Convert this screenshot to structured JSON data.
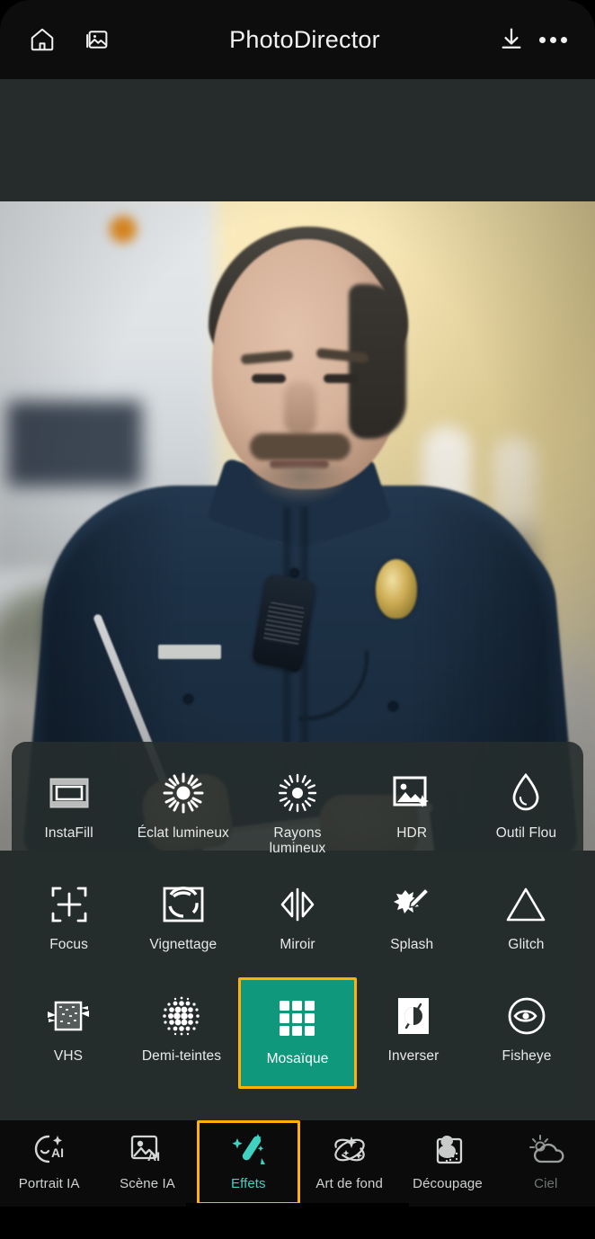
{
  "topbar": {
    "title": "PhotoDirector",
    "home_icon": "home-icon",
    "gallery_icon": "gallery-icon",
    "download_icon": "download-icon",
    "more_icon": "more-options-icon"
  },
  "photo": {
    "alt": "police officer writing on a notepad, blurred street background"
  },
  "effects_panel": {
    "selected": "Mosaïque",
    "selected_bg": "#10987c",
    "selection_border": "#ffb300",
    "rows": [
      [
        {
          "label": "InstaFill",
          "icon": "instafill-icon"
        },
        {
          "label": "Éclat lumineux",
          "icon": "light-burst-icon"
        },
        {
          "label": "Rayons\nlumineux",
          "icon": "light-rays-icon"
        },
        {
          "label": "HDR",
          "icon": "hdr-icon"
        },
        {
          "label": "Outil Flou",
          "icon": "blur-tool-icon"
        }
      ],
      [
        {
          "label": "Focus",
          "icon": "focus-icon"
        },
        {
          "label": "Vignettage",
          "icon": "vignette-icon"
        },
        {
          "label": "Miroir",
          "icon": "mirror-icon"
        },
        {
          "label": "Splash",
          "icon": "splash-icon"
        },
        {
          "label": "Glitch",
          "icon": "glitch-icon"
        }
      ],
      [
        {
          "label": "VHS",
          "icon": "vhs-icon"
        },
        {
          "label": "Demi-teintes",
          "icon": "halftone-icon"
        },
        {
          "label": "Mosaïque",
          "icon": "mosaic-icon"
        },
        {
          "label": "Inverser",
          "icon": "invert-icon"
        },
        {
          "label": "Fisheye",
          "icon": "fisheye-icon"
        }
      ]
    ]
  },
  "bottom_nav": {
    "active": "Effets",
    "active_color": "#3fd2c0",
    "active_border": "#ffb300",
    "items": [
      {
        "label": "Portrait IA",
        "icon": "ai-portrait-icon"
      },
      {
        "label": "Scène IA",
        "icon": "ai-scene-icon"
      },
      {
        "label": "Effets",
        "icon": "magic-wand-icon"
      },
      {
        "label": "Art de fond",
        "icon": "background-art-icon"
      },
      {
        "label": "Découpage",
        "icon": "cutout-icon"
      },
      {
        "label": "Ciel",
        "icon": "sky-icon"
      }
    ]
  }
}
